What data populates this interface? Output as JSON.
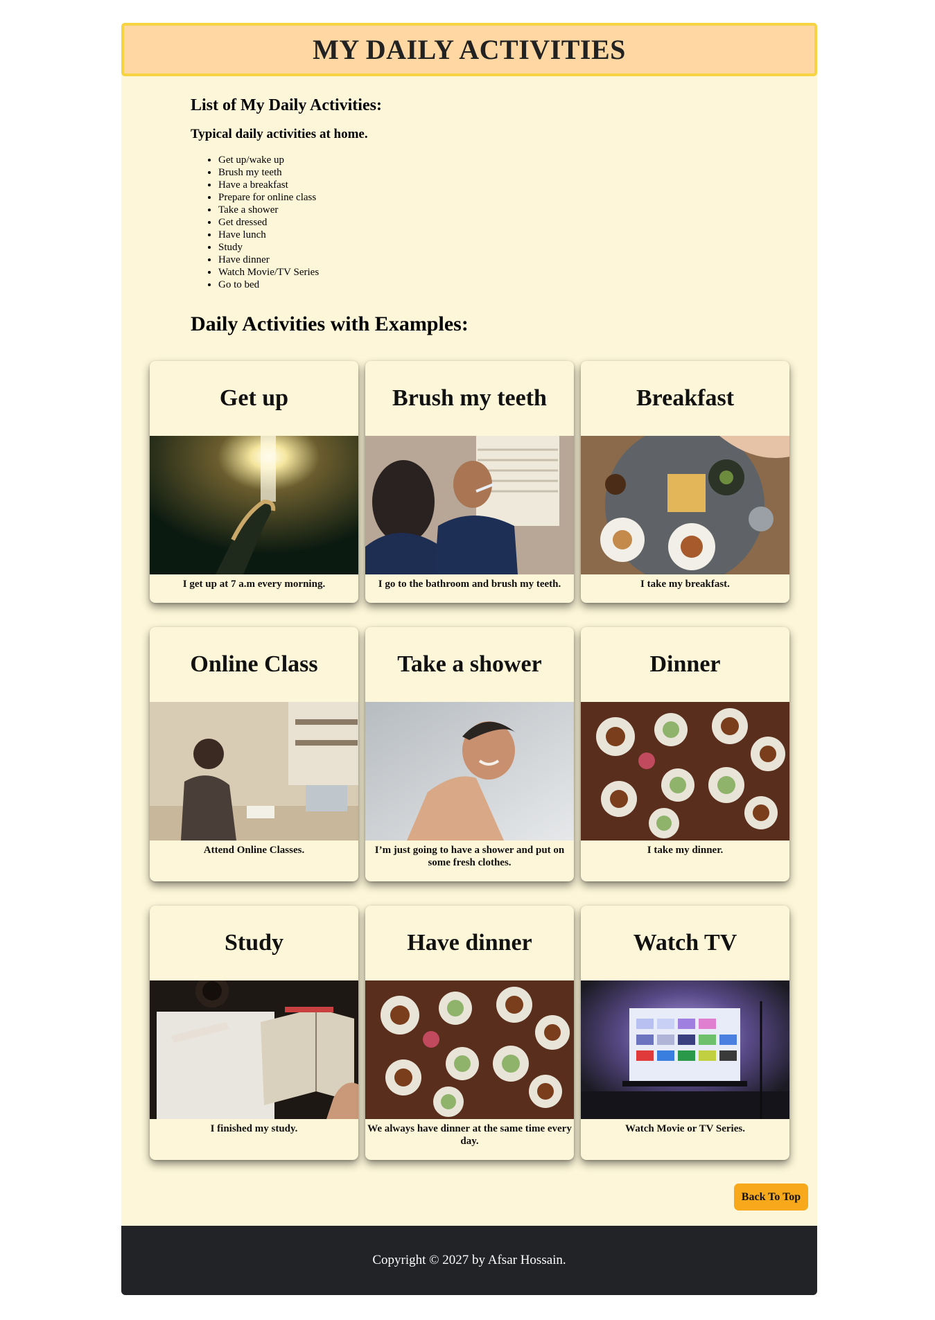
{
  "header": {
    "title": "MY DAILY ACTIVITIES"
  },
  "intro": {
    "heading": "List of My Daily Activities:",
    "subheading": "Typical daily activities at home.",
    "items": [
      "Get up/wake up",
      "Brush my teeth",
      "Have a breakfast",
      "Prepare for online class",
      "Take a shower",
      "Get dressed",
      "Have lunch",
      "Study",
      "Have dinner",
      "Watch Movie/TV Series",
      "Go to bed"
    ]
  },
  "examples": {
    "heading": "Daily Activities with Examples:",
    "cards": [
      {
        "title": "Get up",
        "caption": "I get up at 7 a.m every morning.",
        "image": "hand-in-light-photo"
      },
      {
        "title": "Brush my teeth",
        "caption": "I go to the bathroom and brush my teeth.",
        "image": "man-brushing-teeth-photo"
      },
      {
        "title": "Breakfast",
        "caption": "I take my breakfast.",
        "image": "breakfast-table-photo"
      },
      {
        "title": "Online Class",
        "caption": "Attend Online Classes.",
        "image": "student-at-laptop-photo"
      },
      {
        "title": "Take a shower",
        "caption": "I’m just going to have a shower and put on some fresh clothes.",
        "image": "man-in-shower-photo"
      },
      {
        "title": "Dinner",
        "caption": "I take my dinner.",
        "image": "dinner-table-photo"
      },
      {
        "title": "Study",
        "caption": "I finished my study.",
        "image": "notebook-and-book-photo"
      },
      {
        "title": "Have dinner",
        "caption": "We always have dinner at the same time every day.",
        "image": "dinner-table-photo"
      },
      {
        "title": "Watch TV",
        "caption": "Watch Movie or TV Series.",
        "image": "tv-screen-photo"
      }
    ]
  },
  "back_to_top": {
    "label": "Back To Top"
  },
  "footer": {
    "text": "Copyright © 2027 by Afsar Hossain."
  },
  "colors": {
    "page_bg": "#fdf6d8",
    "banner_bg": "#ffd7a3",
    "banner_border": "#f8d341",
    "button_bg": "#f8a81b",
    "footer_bg": "#212326"
  }
}
